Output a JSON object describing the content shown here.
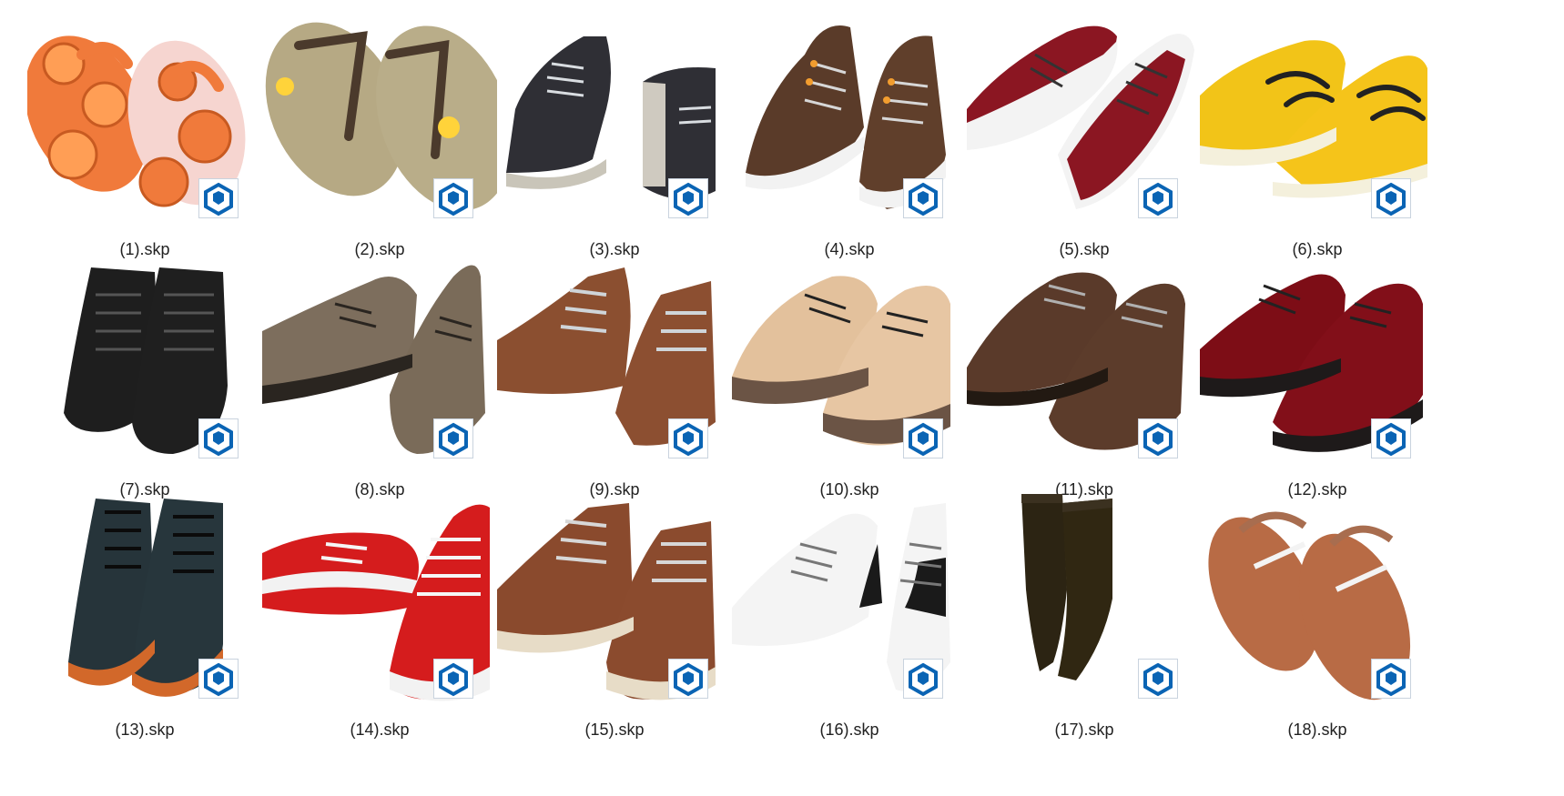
{
  "files": [
    {
      "name": "(1).skp",
      "kind": "flipflop-orange"
    },
    {
      "name": "(2).skp",
      "kind": "flipflop-wood"
    },
    {
      "name": "(3).skp",
      "kind": "sneaker-black"
    },
    {
      "name": "(4).skp",
      "kind": "boot-brown-laced"
    },
    {
      "name": "(5).skp",
      "kind": "sneaker-red-white"
    },
    {
      "name": "(6).skp",
      "kind": "sneaker-yellow"
    },
    {
      "name": "(7).skp",
      "kind": "boot-black-tall"
    },
    {
      "name": "(8).skp",
      "kind": "shoe-stone"
    },
    {
      "name": "(9).skp",
      "kind": "shoe-brown-casual"
    },
    {
      "name": "(10).skp",
      "kind": "shoe-tan-two-tone"
    },
    {
      "name": "(11).skp",
      "kind": "shoe-brown-textured"
    },
    {
      "name": "(12).skp",
      "kind": "shoe-red-dress"
    },
    {
      "name": "(13).skp",
      "kind": "boot-teal-combat"
    },
    {
      "name": "(14).skp",
      "kind": "sneaker-red-canvas"
    },
    {
      "name": "(15).skp",
      "kind": "boot-brown-moc"
    },
    {
      "name": "(16).skp",
      "kind": "sneaker-white-black"
    },
    {
      "name": "(17).skp",
      "kind": "boot-knee-high"
    },
    {
      "name": "(18).skp",
      "kind": "sandal-brown"
    }
  ],
  "icons": {
    "file_badge": "sketchup-file-icon"
  },
  "colors": {
    "badge_blue": "#0a64b4",
    "label_text": "#222222"
  }
}
